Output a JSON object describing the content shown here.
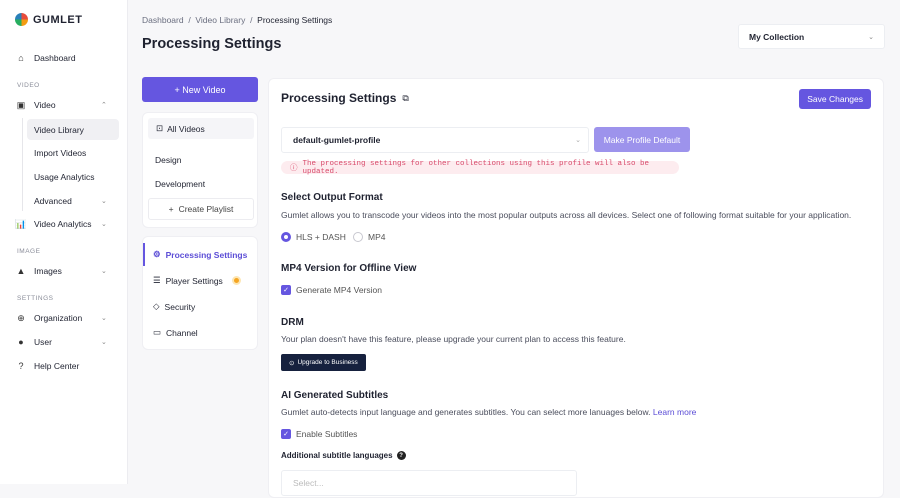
{
  "brand": "GUMLET",
  "sidebar": {
    "dashboard": "Dashboard",
    "sec_video": "VIDEO",
    "video": "Video",
    "video_sub": [
      "Video Library",
      "Import Videos",
      "Usage Analytics",
      "Advanced"
    ],
    "video_analytics": "Video Analytics",
    "sec_image": "IMAGE",
    "images": "Images",
    "sec_settings": "SETTINGS",
    "organization": "Organization",
    "user": "User",
    "help": "Help Center"
  },
  "breadcrumb": [
    "Dashboard",
    "Video Library",
    "Processing Settings"
  ],
  "page_title": "Processing Settings",
  "collection": "My Collection",
  "new_video": "+ New Video",
  "playlists": {
    "all": "All Videos",
    "items": [
      "Design",
      "Development"
    ],
    "create": "Create Playlist"
  },
  "tabs": [
    "Processing Settings",
    "Player Settings",
    "Security",
    "Channel"
  ],
  "main": {
    "title": "Processing Settings",
    "save": "Save Changes",
    "profile": "default-gumlet-profile",
    "make_default": "Make Profile Default",
    "warning": "The processing settings for other collections using this profile will also be updated.",
    "output_title": "Select Output Format",
    "output_desc": "Gumlet allows you to transcode your videos into the most popular outputs across all devices. Select one of following format suitable for your application.",
    "formats": [
      "HLS + DASH",
      "MP4"
    ],
    "selected_format": "HLS + DASH",
    "mp4_title": "MP4 Version for Offline View",
    "mp4_option": "Generate MP4 Version",
    "mp4_checked": true,
    "drm_title": "DRM",
    "drm_desc": "Your plan doesn't have this feature, please upgrade your current plan to access this feature.",
    "upgrade": "Upgrade to Business",
    "subs_title": "AI Generated Subtitles",
    "subs_desc": "Gumlet auto-detects input language and generates subtitles. You can select more lanuages below.",
    "learn_more": "Learn more",
    "subs_option": "Enable Subtitles",
    "subs_checked": true,
    "add_lang_label": "Additional subtitle languages",
    "add_lang_placeholder": "Select..."
  },
  "colors": {
    "accent": "#6556e0",
    "warning": "#d84a6b",
    "dark_button": "#16213e"
  }
}
